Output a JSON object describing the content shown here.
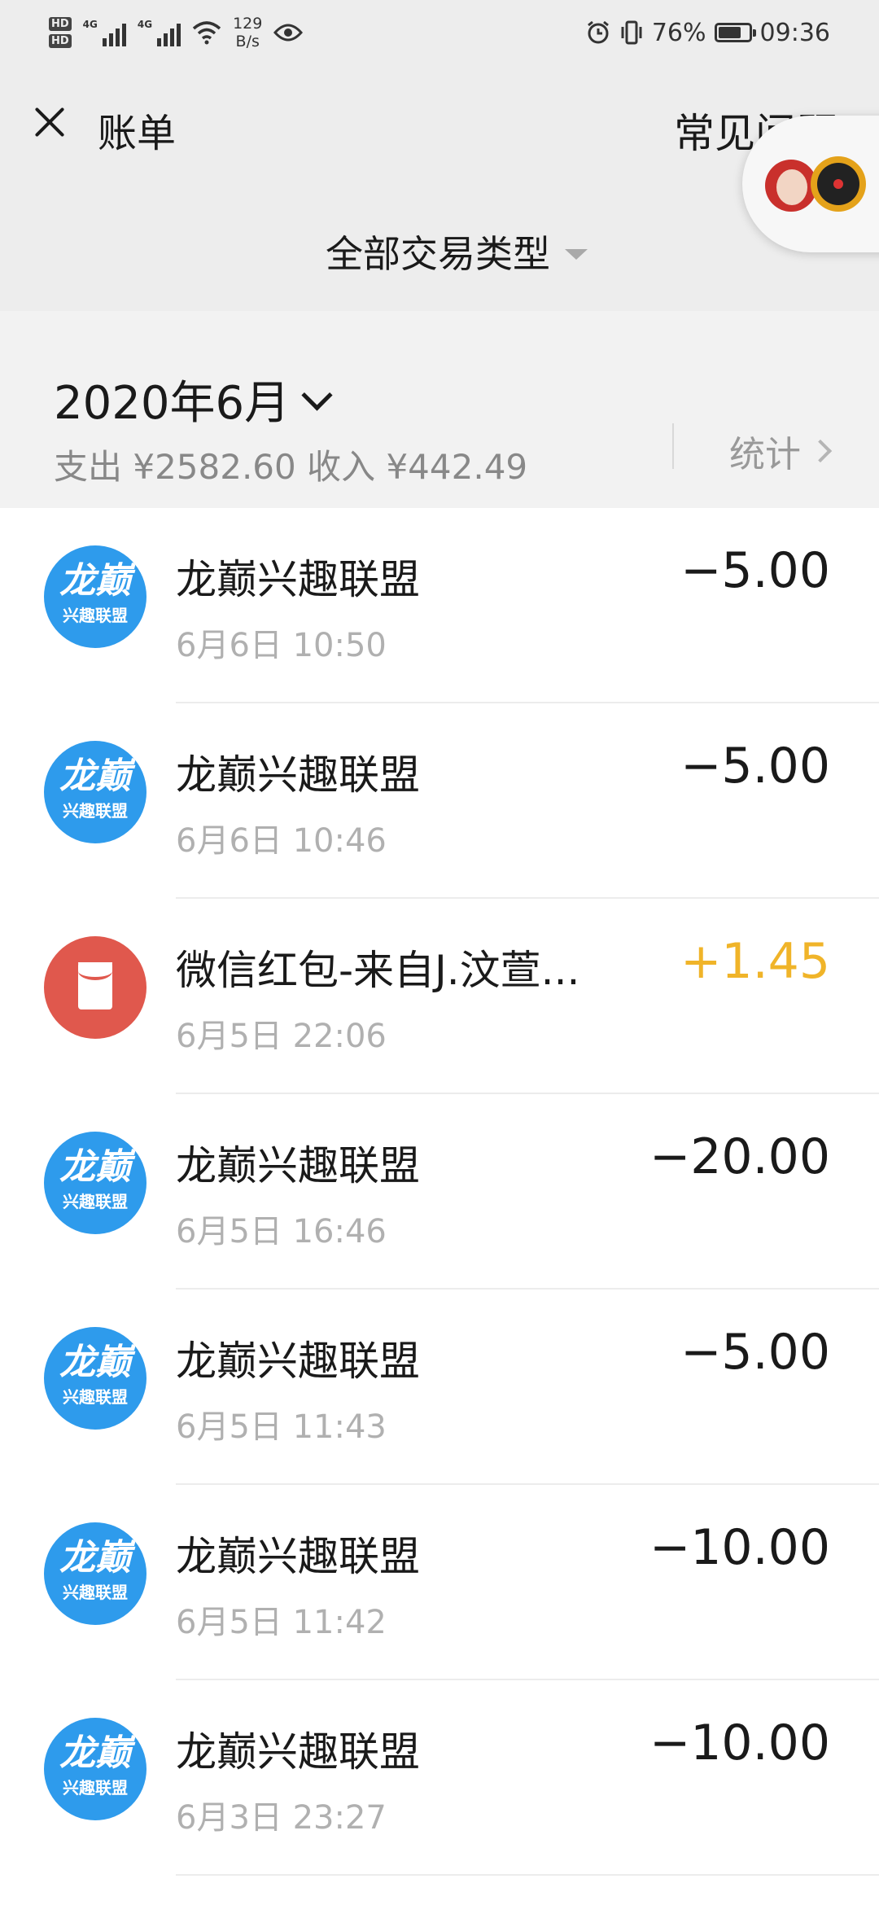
{
  "status_bar": {
    "hd1": "HD",
    "hd2": "HD",
    "sig1_label": "4G",
    "sig2_label": "4G",
    "net_speed_value": "129",
    "net_speed_unit": "B/s",
    "battery_percent": "76%",
    "battery_level": 0.76,
    "time": "09:36",
    "icons": [
      "eye-icon",
      "alarm-icon",
      "vibrate-icon",
      "wifi-icon",
      "battery-icon"
    ]
  },
  "header": {
    "title": "账单",
    "faq": "常见问题"
  },
  "filter": {
    "label": "全部交易类型"
  },
  "month": {
    "label": "2020年6月",
    "summary": "支出 ¥2582.60 收入 ¥442.49",
    "stats": "统计"
  },
  "avatar_text": {
    "big": "龙巅",
    "small": "兴趣联盟"
  },
  "colors": {
    "income": "#f0b429",
    "avatar_blue": "#2e9bec",
    "red_packet": "#e0584d"
  },
  "transactions": [
    {
      "name": "龙巅兴趣联盟",
      "time": "6月6日 10:50",
      "amount": "−5.00",
      "type": "expense"
    },
    {
      "name": "龙巅兴趣联盟",
      "time": "6月6日 10:46",
      "amount": "−5.00",
      "type": "expense"
    },
    {
      "name": "微信红包-来自J.汶萱...",
      "time": "6月5日 22:06",
      "amount": "+1.45",
      "type": "income"
    },
    {
      "name": "龙巅兴趣联盟",
      "time": "6月5日 16:46",
      "amount": "−20.00",
      "type": "expense"
    },
    {
      "name": "龙巅兴趣联盟",
      "time": "6月5日 11:43",
      "amount": "−5.00",
      "type": "expense"
    },
    {
      "name": "龙巅兴趣联盟",
      "time": "6月5日 11:42",
      "amount": "−10.00",
      "type": "expense"
    },
    {
      "name": "龙巅兴趣联盟",
      "time": "6月3日 23:27",
      "amount": "−10.00",
      "type": "expense"
    }
  ]
}
